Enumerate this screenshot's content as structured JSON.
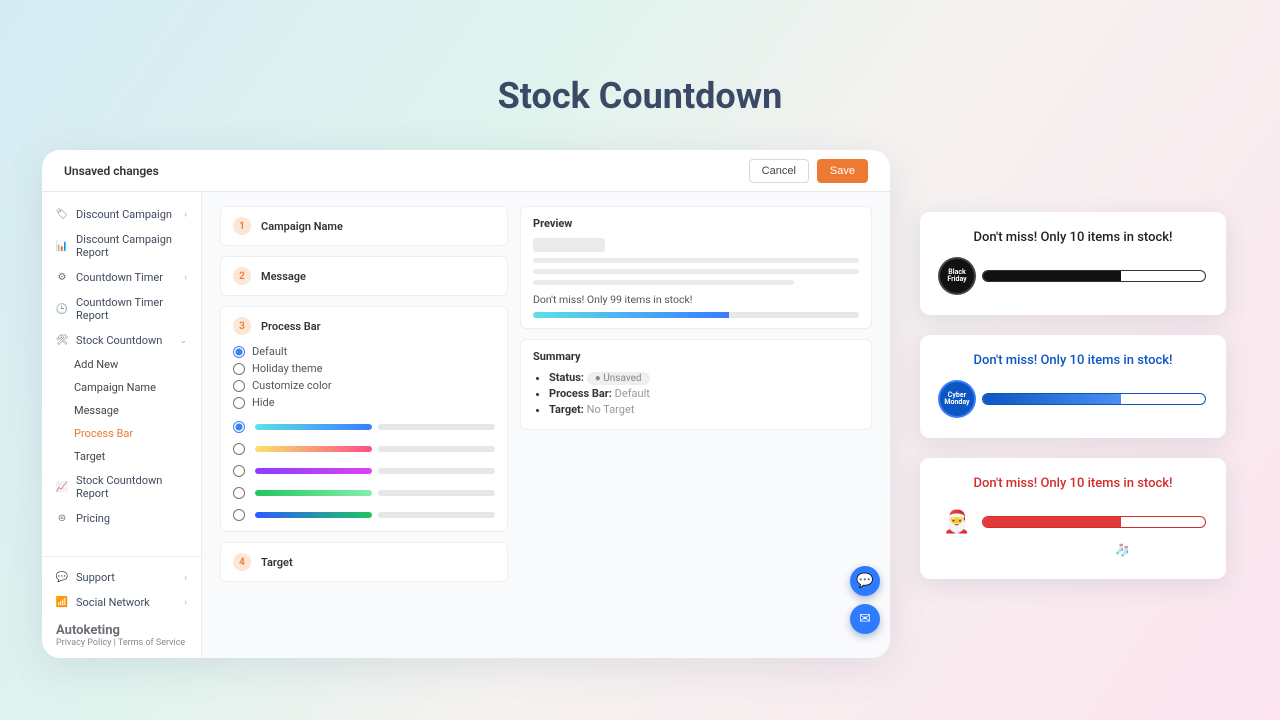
{
  "page_title": "Stock Countdown",
  "topbar": {
    "title": "Unsaved changes",
    "cancel": "Cancel",
    "save": "Save"
  },
  "sidebar": {
    "items": [
      {
        "label": "Discount Campaign",
        "icon": "🏷"
      },
      {
        "label": "Discount Campaign Report",
        "icon": "📊"
      },
      {
        "label": "Countdown Timer",
        "icon": "⚙"
      },
      {
        "label": "Countdown Timer Report",
        "icon": "🕒"
      },
      {
        "label": "Stock Countdown",
        "icon": "🛠"
      },
      {
        "label": "Stock Countdown Report",
        "icon": "📈"
      },
      {
        "label": "Pricing",
        "icon": "⊜"
      }
    ],
    "stock_sub": [
      {
        "label": "Add New"
      },
      {
        "label": "Campaign Name"
      },
      {
        "label": "Message"
      },
      {
        "label": "Process Bar"
      },
      {
        "label": "Target"
      }
    ],
    "bottom": [
      {
        "label": "Support",
        "icon": "💬"
      },
      {
        "label": "Social Network",
        "icon": "📶"
      }
    ],
    "brand": "Autoketing",
    "brand_links": "Privacy Policy | Terms of Service"
  },
  "steps": {
    "1": "Campaign Name",
    "2": "Message",
    "3": "Process Bar",
    "4": "Target"
  },
  "process_bar_options": [
    "Default",
    "Holiday theme",
    "Customize color",
    "Hide"
  ],
  "gradients": [
    [
      "#5de1e6",
      "#3a7cff"
    ],
    [
      "#f8e36b",
      "#ff4e88"
    ],
    [
      "#8b3cff",
      "#d946ef"
    ],
    [
      "#22c55e",
      "#86efac"
    ],
    [
      "#2d5bff",
      "#22c55e"
    ]
  ],
  "preview": {
    "title": "Preview",
    "message": "Don't miss! Only 99 items in stock!"
  },
  "summary": {
    "title": "Summary",
    "status_label": "Status:",
    "status_value": "Unsaved",
    "process_label": "Process Bar:",
    "process_value": "Default",
    "target_label": "Target:",
    "target_value": "No Target"
  },
  "demos": [
    {
      "text": "Don't miss! Only 10 items in stock!",
      "badge": "Black Friday"
    },
    {
      "text": "Don't miss! Only 10 items in stock!",
      "badge": "Cyber Monday"
    },
    {
      "text": "Don't miss! Only 10 items in stock!",
      "badge": "🎅"
    }
  ]
}
